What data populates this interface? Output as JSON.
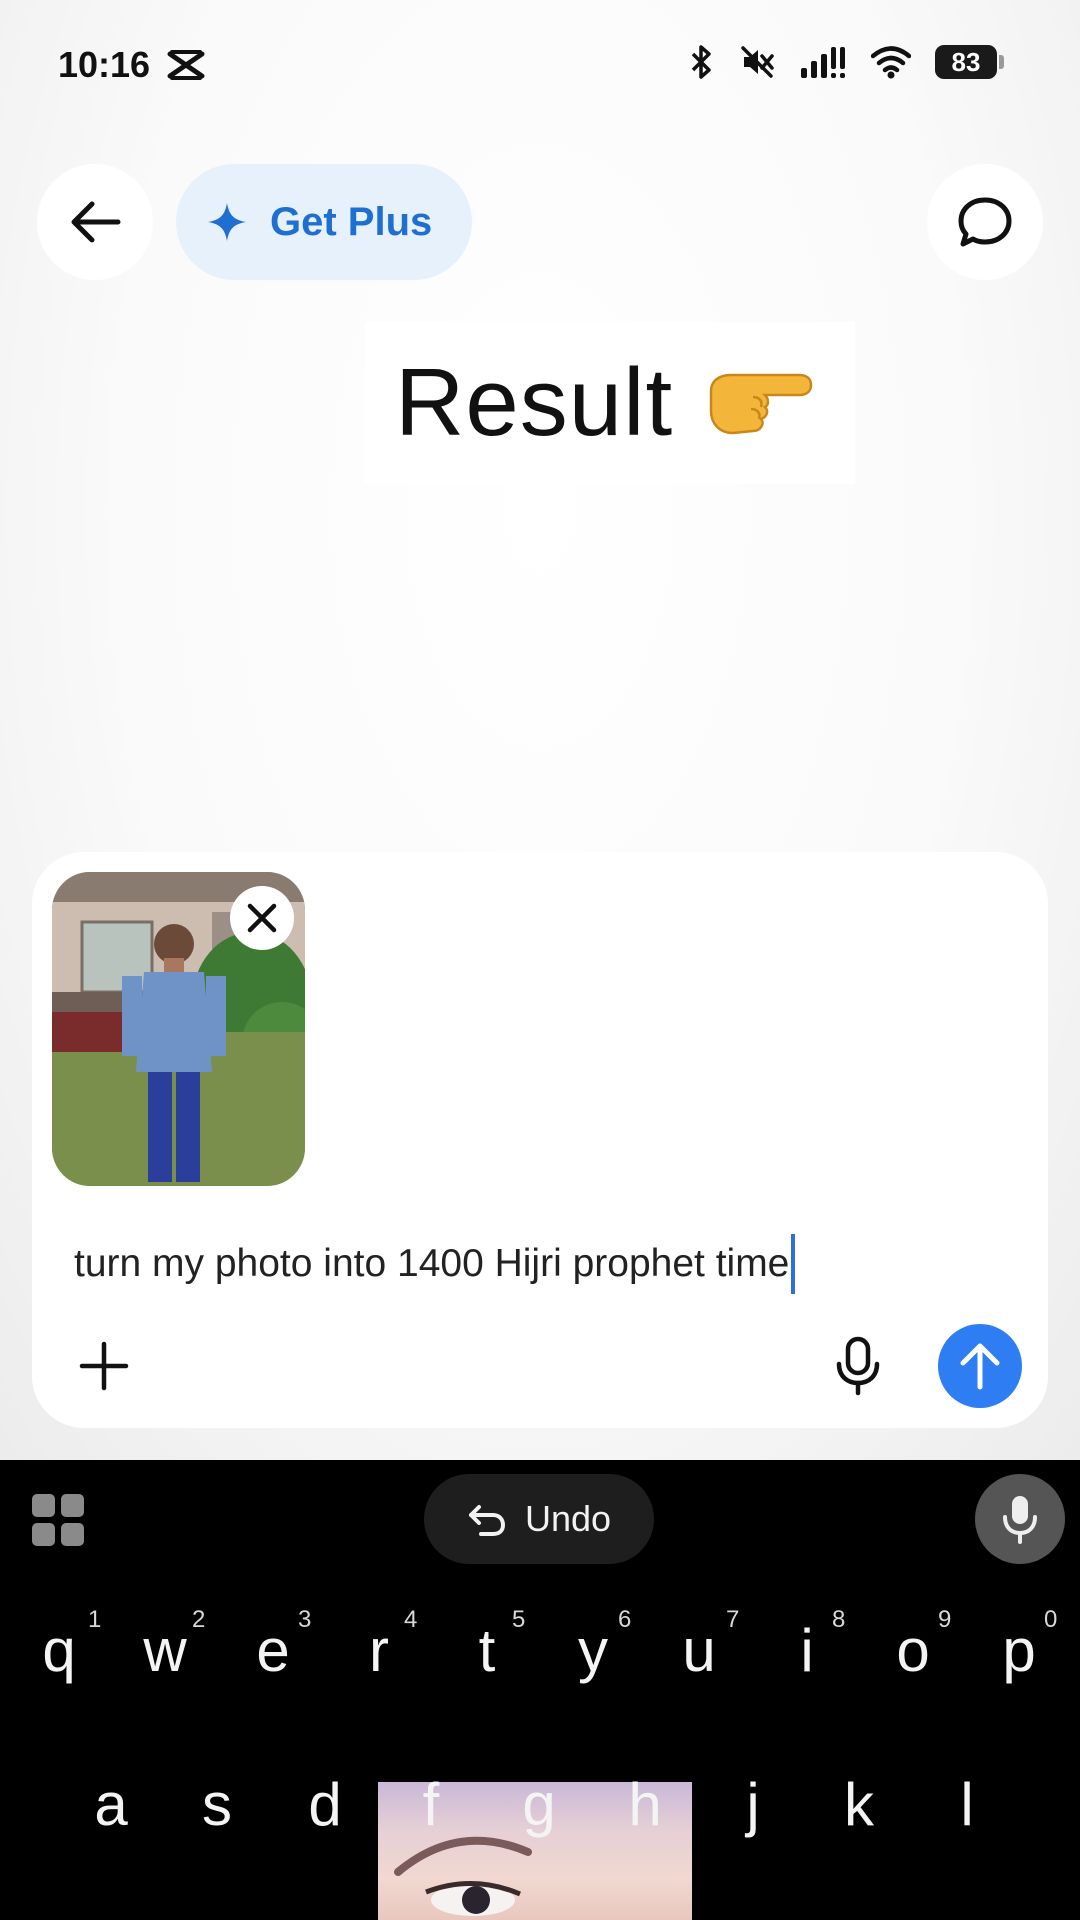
{
  "status_bar": {
    "time": "10:16",
    "battery": "83",
    "icons": [
      "capcut-icon",
      "bluetooth-icon",
      "mute-icon",
      "signal-icon",
      "wifi-icon",
      "battery-icon"
    ]
  },
  "header": {
    "back_icon": "arrow-left-icon",
    "plus_label": "Get Plus",
    "plus_icon": "sparkle-icon",
    "new_chat_icon": "chat-bubble-icon"
  },
  "overlay": {
    "result_text": "Result",
    "emoji": "👉"
  },
  "composer": {
    "attachment_remove_icon": "close-icon",
    "prompt_text": "turn my photo into 1400 Hijri prophet time",
    "add_icon": "plus-icon",
    "mic_icon": "microphone-icon",
    "send_icon": "arrow-up-icon"
  },
  "keyboard": {
    "undo_label": "Undo",
    "row1": [
      {
        "key": "q",
        "hint": "1"
      },
      {
        "key": "w",
        "hint": "2"
      },
      {
        "key": "e",
        "hint": "3"
      },
      {
        "key": "r",
        "hint": "4"
      },
      {
        "key": "t",
        "hint": "5"
      },
      {
        "key": "y",
        "hint": "6"
      },
      {
        "key": "u",
        "hint": "7"
      },
      {
        "key": "i",
        "hint": "8"
      },
      {
        "key": "o",
        "hint": "9"
      },
      {
        "key": "p",
        "hint": "0"
      }
    ],
    "row2": [
      "a",
      "s",
      "d",
      "f",
      "g",
      "h",
      "j",
      "k",
      "l"
    ]
  },
  "colors": {
    "accent_blue": "#2f7df3",
    "plus_text": "#1f6fd1",
    "plus_bg": "#e7f1fc",
    "keyboard_bg": "#000000"
  }
}
